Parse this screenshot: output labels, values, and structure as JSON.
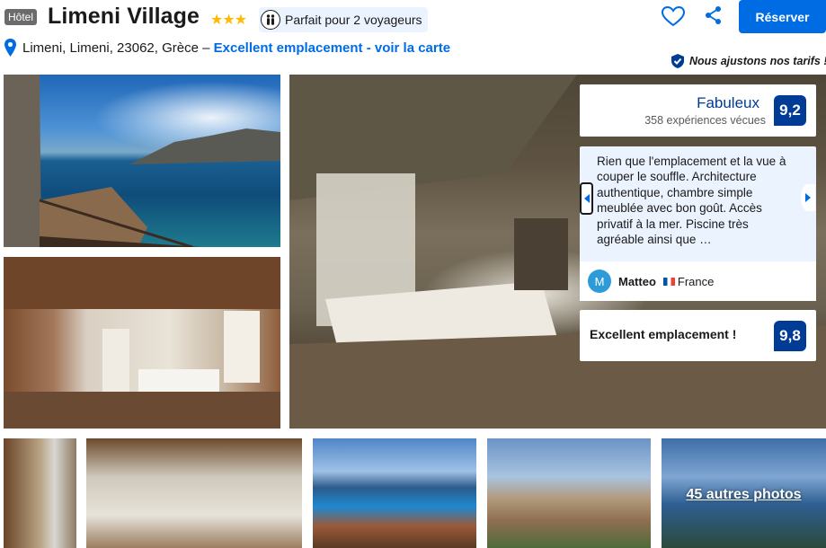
{
  "header": {
    "type_label": "Hôtel",
    "name": "Limeni Village",
    "stars": "★★★",
    "travel_badge": "Parfait pour 2 voyageurs",
    "reserve_label": "Réserver"
  },
  "location": {
    "address": "Limeni, Limeni, 23062, Grèce – ",
    "map_link": "Excellent emplacement - voir la carte"
  },
  "price_note": "Nous ajustons nos tarifs !",
  "rating": {
    "word": "Fabuleux",
    "count": "358 expériences vécues",
    "score": "9,2"
  },
  "review": {
    "text": "Rien que l'emplacement et la vue à couper le souffle. Architecture authentique, chambre simple meublée avec bon goût. Accès privatif à la mer. Piscine très agréable ainsi que …",
    "reviewer_initial": "M",
    "reviewer_name": "Matteo",
    "reviewer_country": "France"
  },
  "location_score": {
    "label": "Excellent emplacement !",
    "score": "9,8"
  },
  "gallery": {
    "more_label": "45 autres photos"
  },
  "colors": {
    "brand_blue": "#006ce4",
    "score_blue": "#003b95",
    "star_yellow": "#febb02",
    "review_bg": "#ebf3ff"
  },
  "icons": [
    "people-icon",
    "heart-icon",
    "share-icon",
    "location-pin-icon",
    "check-shield-icon",
    "chevron-left-icon",
    "chevron-right-icon"
  ]
}
